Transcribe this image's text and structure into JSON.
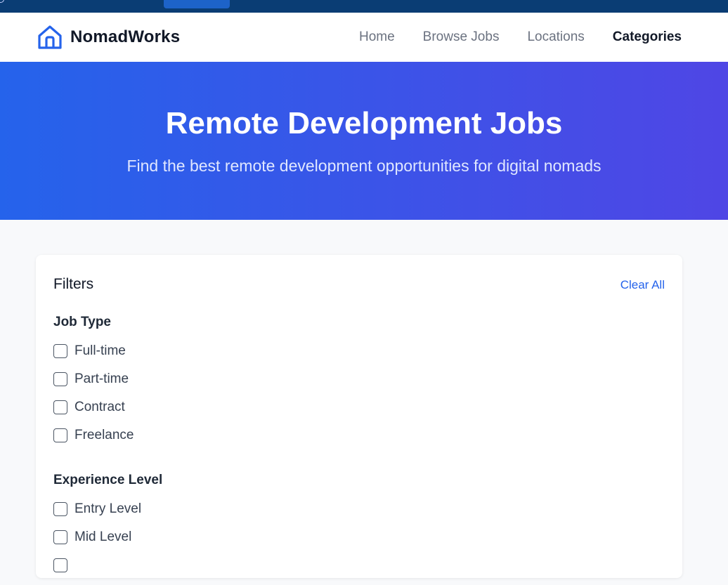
{
  "brand": {
    "name": "NomadWorks",
    "accent": "#2563eb",
    "icon": "home-icon"
  },
  "nav": {
    "links": [
      {
        "label": "Home",
        "active": false
      },
      {
        "label": "Browse Jobs",
        "active": false
      },
      {
        "label": "Locations",
        "active": false
      },
      {
        "label": "Categories",
        "active": true
      }
    ]
  },
  "hero": {
    "title": "Remote Development Jobs",
    "subtitle": "Find the best remote development opportunities for digital nomads",
    "gradient": [
      "#2563eb",
      "#4f46e5"
    ]
  },
  "filters": {
    "title": "Filters",
    "clear_label": "Clear All",
    "job_type": {
      "title": "Job Type",
      "options": [
        {
          "label": "Full-time",
          "checked": false
        },
        {
          "label": "Part-time",
          "checked": false
        },
        {
          "label": "Contract",
          "checked": false
        },
        {
          "label": "Freelance",
          "checked": false
        }
      ]
    },
    "experience": {
      "title": "Experience Level",
      "options": [
        {
          "label": "Entry Level",
          "checked": false
        },
        {
          "label": "Mid Level",
          "checked": false
        }
      ]
    }
  }
}
